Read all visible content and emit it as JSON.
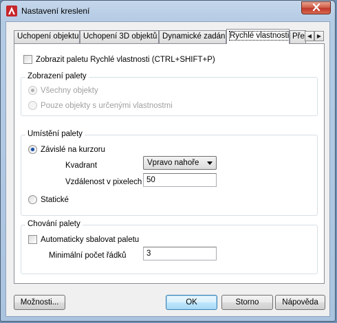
{
  "window": {
    "title": "Nastavení kreslení",
    "accent": "#c7262b"
  },
  "tabs": [
    {
      "label": "Uchopení objektu"
    },
    {
      "label": "Uchopení 3D objektů"
    },
    {
      "label": "Dynamické zadání"
    },
    {
      "label": "Rychlé vlastnosti",
      "active": true
    },
    {
      "label": "Pře"
    }
  ],
  "show_palette": {
    "label": "Zobrazit paletu Rychlé vlastnosti (CTRL+SHIFT+P)",
    "checked": false
  },
  "palette_display": {
    "label": "Zobrazení palety",
    "options": [
      {
        "label": "Všechny objekty",
        "selected": true,
        "enabled": false
      },
      {
        "label": "Pouze objekty s určenými vlastnostmi",
        "selected": false,
        "enabled": false
      }
    ]
  },
  "palette_location": {
    "label": "Umístění palety",
    "cursor_dependent": {
      "label": "Závislé na kurzoru",
      "selected": true
    },
    "quadrant": {
      "label": "Kvadrant",
      "value": "Vpravo nahoře"
    },
    "distance": {
      "label": "Vzdálenost v pixelech",
      "value": "50"
    },
    "static": {
      "label": "Statické",
      "selected": false
    }
  },
  "palette_behavior": {
    "label": "Chování palety",
    "auto_collapse": {
      "label": "Automaticky sbalovat paletu",
      "checked": false
    },
    "min_rows": {
      "label": "Minimální počet řádků",
      "value": "3"
    }
  },
  "buttons": {
    "options": "Možnosti...",
    "ok": "OK",
    "cancel": "Storno",
    "help": "Nápověda"
  }
}
